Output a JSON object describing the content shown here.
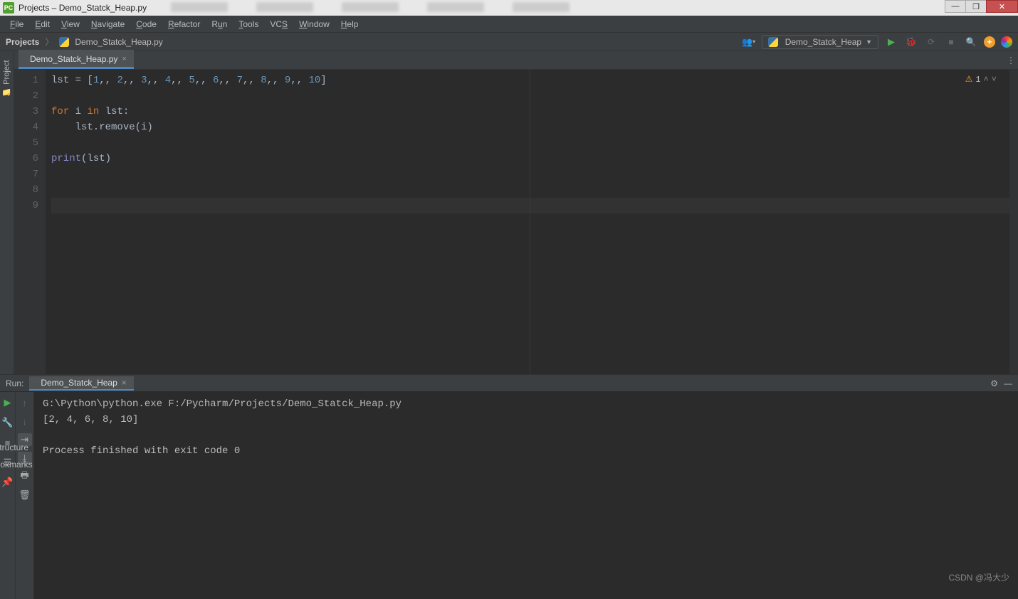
{
  "title": {
    "app_icon": "PC",
    "text": "Projects – Demo_Statck_Heap.py"
  },
  "win_controls": {
    "min": "—",
    "max": "❐",
    "close": "✕"
  },
  "menu": [
    "File",
    "Edit",
    "View",
    "Navigate",
    "Code",
    "Refactor",
    "Run",
    "Tools",
    "VCS",
    "Window",
    "Help"
  ],
  "breadcrumb": {
    "project": "Projects",
    "file": "Demo_Statck_Heap.py"
  },
  "run_config": {
    "label": "Demo_Statck_Heap"
  },
  "toolbar_icons": {
    "users": "👥",
    "run": "▶",
    "debug": "🐞",
    "cov": "⟳",
    "stop": "■",
    "search": "🔍",
    "add": "+"
  },
  "side_tabs": {
    "project": "Project",
    "structure": "Structure",
    "bookmarks": "Bookmarks"
  },
  "editor_tab": {
    "name": "Demo_Statck_Heap.py"
  },
  "code_lines": [
    {
      "n": 1,
      "tokens": [
        [
          "",
          "lst = ["
        ],
        [
          "num",
          "1"
        ],
        [
          "",
          ","
        ],
        [
          "",
          ", "
        ],
        [
          "num",
          "2"
        ],
        [
          "",
          ","
        ],
        [
          "",
          ", "
        ],
        [
          "num",
          "3"
        ],
        [
          "",
          ","
        ],
        [
          "",
          ", "
        ],
        [
          "num",
          "4"
        ],
        [
          "",
          ","
        ],
        [
          "",
          ", "
        ],
        [
          "num",
          "5"
        ],
        [
          "",
          ","
        ],
        [
          "",
          ", "
        ],
        [
          "num",
          "6"
        ],
        [
          "",
          ","
        ],
        [
          "",
          ", "
        ],
        [
          "num",
          "7"
        ],
        [
          "",
          ","
        ],
        [
          "",
          ", "
        ],
        [
          "num",
          "8"
        ],
        [
          "",
          ","
        ],
        [
          "",
          ", "
        ],
        [
          "num",
          "9"
        ],
        [
          "",
          ","
        ],
        [
          "",
          ", "
        ],
        [
          "num",
          "10"
        ],
        [
          "",
          "]"
        ]
      ]
    },
    {
      "n": 2,
      "tokens": []
    },
    {
      "n": 3,
      "tokens": [
        [
          "kw",
          "for"
        ],
        [
          "",
          " i "
        ],
        [
          "kw",
          "in"
        ],
        [
          "",
          " lst:"
        ]
      ]
    },
    {
      "n": 4,
      "tokens": [
        [
          "",
          "    lst.remove(i)"
        ]
      ]
    },
    {
      "n": 5,
      "tokens": []
    },
    {
      "n": 6,
      "tokens": [
        [
          "builtin",
          "print"
        ],
        [
          "",
          "(lst)"
        ]
      ]
    },
    {
      "n": 7,
      "tokens": []
    },
    {
      "n": 8,
      "tokens": []
    },
    {
      "n": 9,
      "tokens": [],
      "current": true
    }
  ],
  "inspection": {
    "warn_count": "1"
  },
  "run_panel": {
    "title": "Run:",
    "tab": "Demo_Statck_Heap",
    "output": [
      "G:\\Python\\python.exe F:/Pycharm/Projects/Demo_Statck_Heap.py",
      "[2, 4, 6, 8, 10]",
      "",
      "Process finished with exit code 0"
    ]
  },
  "watermark": "CSDN @冯大少"
}
